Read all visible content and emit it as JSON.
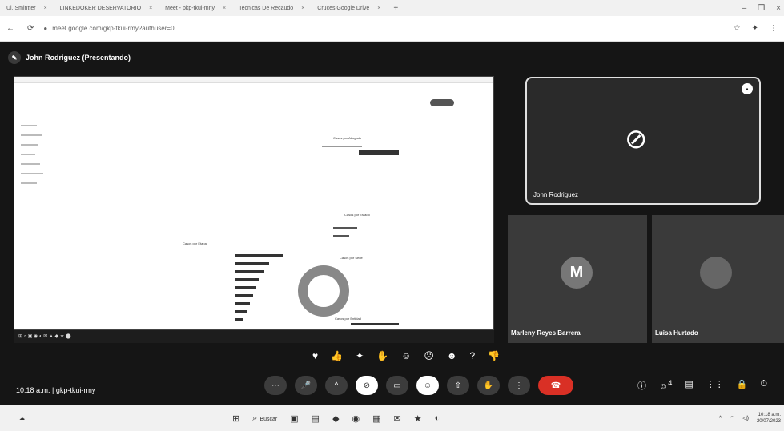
{
  "browser": {
    "tabs": [
      {
        "label": "Ul. Smintter"
      },
      {
        "label": "LINKEDOKER DESERVATORIO"
      },
      {
        "label": "Meet - pkp-tkui-mny"
      },
      {
        "label": "Tecnicas De Recaudo"
      },
      {
        "label": "Cruces Google Drive"
      }
    ],
    "url": "meet.google.com/gkp-tkui-rmy?authuser=0"
  },
  "meet": {
    "presenter_label": "John Rodriguez (Presentando)",
    "self_tile_name": "John Rodriguez",
    "participants": [
      {
        "name": "Marleny Reyes Barrera",
        "initial": "M"
      },
      {
        "name": "Luisa Hurtado",
        "initial": ""
      }
    ],
    "time": "10:18 a.m.",
    "separator": "|",
    "meeting_code": "gkp-tkui-rmy",
    "participant_count": "4"
  },
  "shared_screen": {
    "charts": [
      {
        "title": "Casos por Abogado"
      },
      {
        "title": "Casos por Estado"
      },
      {
        "title": "Casos por Etapa"
      },
      {
        "title": "Casos por Sede"
      },
      {
        "title": "Casos por Entidad"
      }
    ]
  },
  "taskbar": {
    "search_placeholder": "Buscar",
    "clock_time": "10:18 a.m.",
    "clock_date": "20/07/2023"
  },
  "colors": {
    "stage_bg": "#151515",
    "hangup": "#d93025",
    "tile_bg": "#3a3a3a"
  }
}
